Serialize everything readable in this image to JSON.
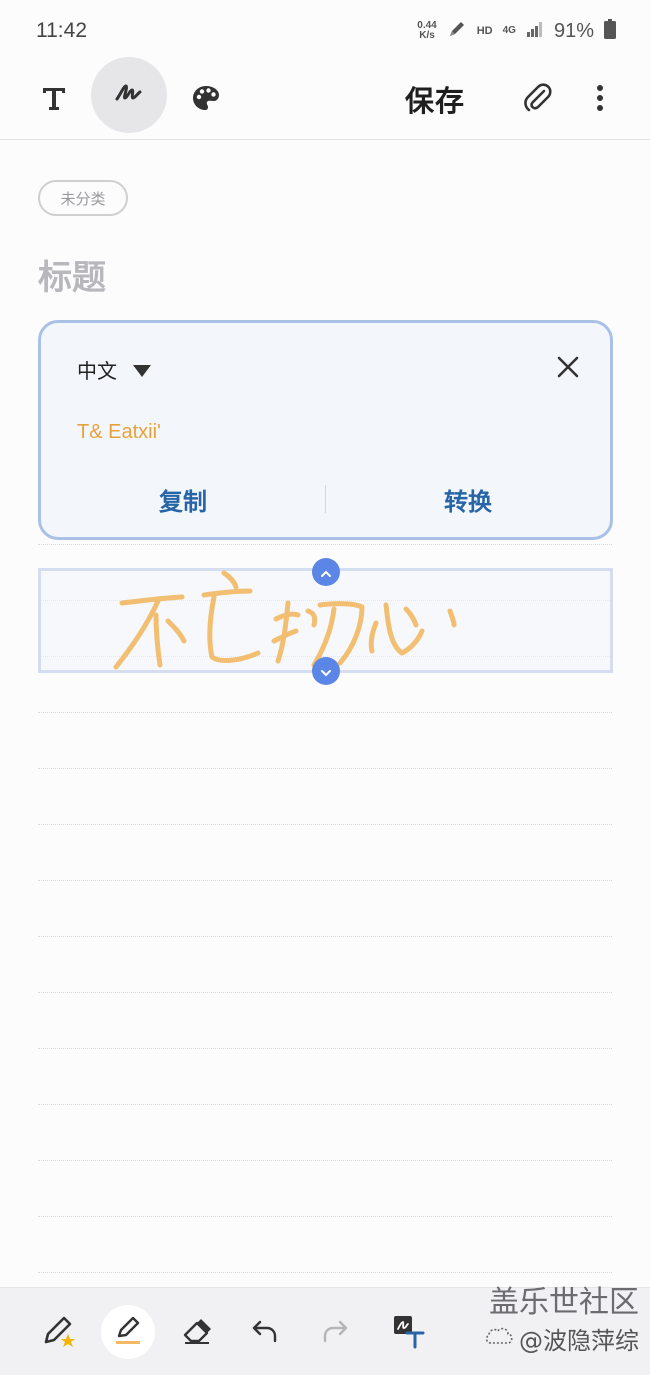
{
  "status_bar": {
    "time": "11:42",
    "net_speed_value": "0.44",
    "net_speed_unit": "K/s",
    "hd": "HD",
    "network": "4G",
    "battery": "91%"
  },
  "toolbar": {
    "save_label": "保存"
  },
  "note": {
    "category": "未分类",
    "title_placeholder": "标题"
  },
  "recognition": {
    "language": "中文",
    "result_text": "T& Eatxii'",
    "copy_label": "复制",
    "convert_label": "转换"
  },
  "watermark": {
    "line1": "盖乐世社区",
    "line2": "@波隐萍综"
  },
  "colors": {
    "accent": "#2765a6",
    "ink": "#f2b864",
    "handle": "#5b86e5",
    "card_border": "#a9c1e6"
  }
}
